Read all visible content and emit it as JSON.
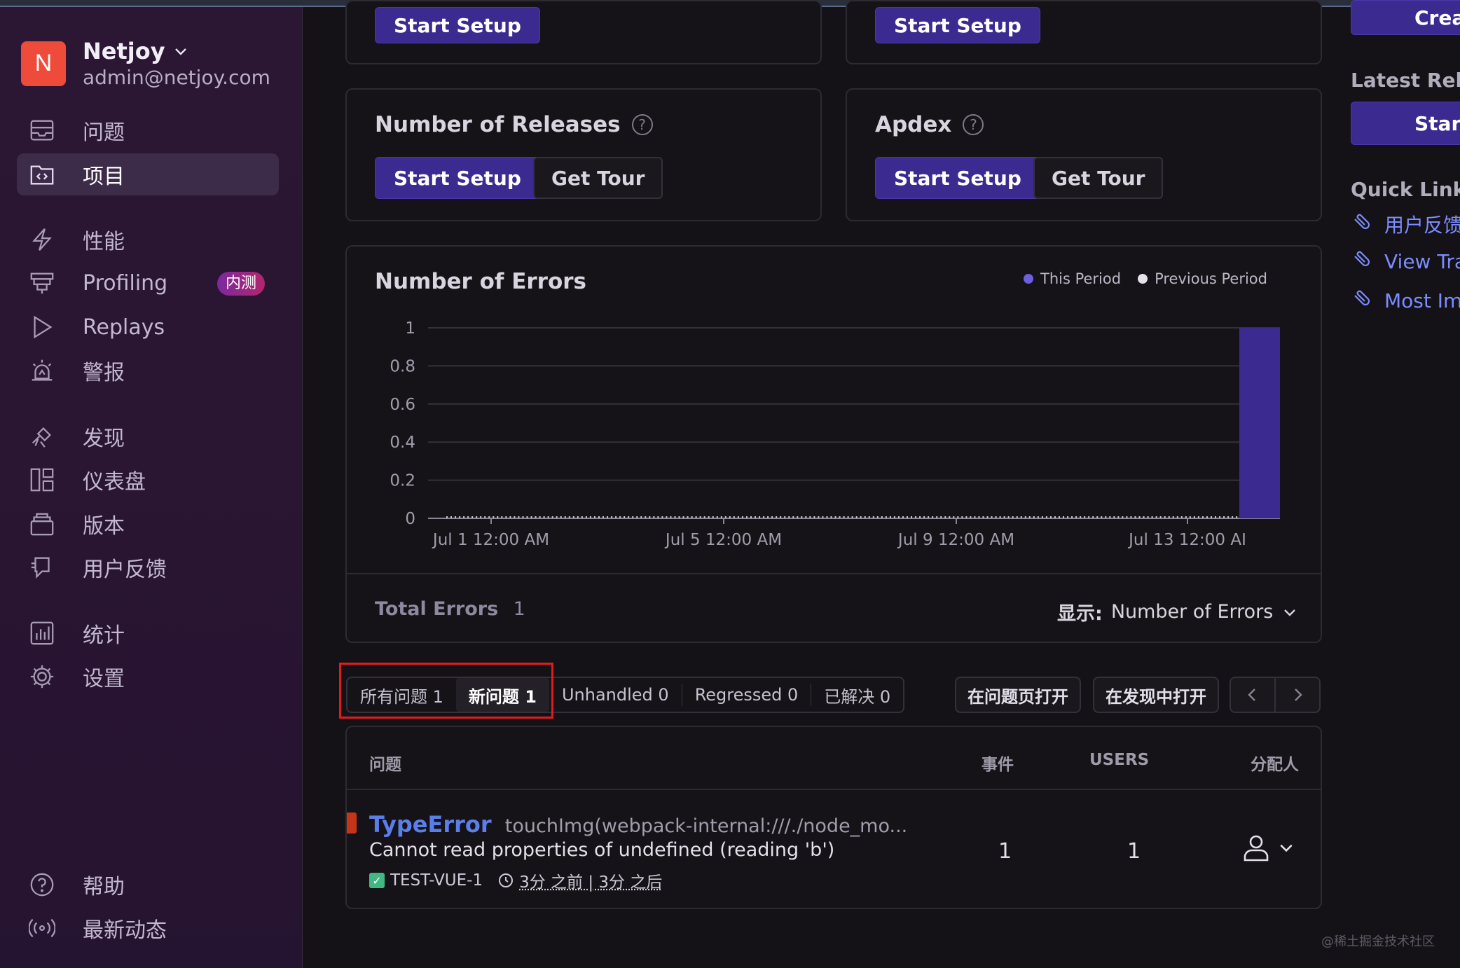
{
  "org": {
    "initial": "N",
    "name": "Netjoy",
    "email": "admin@netjoy.com"
  },
  "sidebar": {
    "items": [
      {
        "label": "问题",
        "icon": "issues-icon"
      },
      {
        "label": "项目",
        "icon": "projects-icon",
        "active": true
      },
      {
        "label": "性能",
        "icon": "performance-icon"
      },
      {
        "label": "Profiling",
        "icon": "profiling-icon",
        "badge": "内测"
      },
      {
        "label": "Replays",
        "icon": "replays-icon"
      },
      {
        "label": "警报",
        "icon": "alerts-icon"
      },
      {
        "label": "发现",
        "icon": "discover-icon"
      },
      {
        "label": "仪表盘",
        "icon": "dashboards-icon"
      },
      {
        "label": "版本",
        "icon": "releases-icon"
      },
      {
        "label": "用户反馈",
        "icon": "user-feedback-icon"
      },
      {
        "label": "统计",
        "icon": "stats-icon"
      },
      {
        "label": "设置",
        "icon": "settings-icon"
      }
    ],
    "bottom": [
      {
        "label": "帮助",
        "icon": "help-icon"
      },
      {
        "label": "最新动态",
        "icon": "broadcast-icon"
      }
    ]
  },
  "cards": {
    "top_left": {
      "start_setup": "Start Setup"
    },
    "top_right": {
      "start_setup": "Start Setup"
    },
    "releases": {
      "title": "Number of Releases",
      "start_setup": "Start Setup",
      "get_tour": "Get Tour"
    },
    "apdex": {
      "title": "Apdex",
      "start_setup": "Start Setup",
      "get_tour": "Get Tour"
    }
  },
  "errors_card": {
    "title": "Number of Errors",
    "total_label": "Total Errors",
    "total_value": "1",
    "display_label": "显示:",
    "display_value": "Number of Errors"
  },
  "colors": {
    "this_period": "#3b2b90",
    "previous_period": "#e6e2ea",
    "accent_link": "#7c8cff",
    "highlight": "#e21b1b"
  },
  "chart_data": {
    "type": "bar",
    "title": "Number of Errors",
    "legend": [
      "This Period",
      "Previous Period"
    ],
    "legend_position": "top-right",
    "x_tick_labels": [
      "Jul 1 12:00 AM",
      "Jul 5 12:00 AM",
      "Jul 9 12:00 AM",
      "Jul 13 12:00 AI"
    ],
    "y_tick_labels": [
      "1",
      "0.8",
      "0.6",
      "0.4",
      "0.2",
      "0"
    ],
    "ylim": [
      0,
      1
    ],
    "grid": true,
    "series": [
      {
        "name": "This Period",
        "values": [
          0,
          0,
          0,
          0,
          0,
          0,
          0,
          0,
          0,
          0,
          0,
          0,
          0,
          0,
          0,
          0,
          0,
          0,
          0,
          0,
          0,
          0,
          0,
          0,
          0,
          0,
          0,
          0,
          0,
          0,
          0,
          0,
          0,
          0,
          0,
          0,
          0,
          0,
          0,
          0,
          0,
          0,
          0,
          0,
          0,
          0,
          0,
          0,
          0,
          0,
          0,
          0,
          0,
          0,
          0,
          0,
          0,
          0,
          0,
          0,
          0,
          0,
          0,
          0,
          0,
          0,
          0,
          0,
          0,
          0,
          0,
          0,
          0,
          0,
          0,
          0,
          0,
          0,
          0,
          0,
          0,
          0,
          0,
          0,
          0,
          0,
          0,
          0,
          0,
          0,
          0,
          0,
          0,
          0,
          0,
          0,
          0,
          0,
          0,
          0,
          0,
          0,
          0,
          0,
          0,
          0,
          0,
          0,
          0,
          0,
          0,
          0,
          0,
          0,
          0,
          0,
          0,
          0,
          0,
          0,
          0,
          0,
          0,
          0,
          0,
          0,
          0,
          0,
          0,
          0,
          0,
          0,
          0,
          0,
          0,
          0,
          0,
          0,
          0,
          0,
          0,
          0,
          0,
          0,
          0,
          0,
          0,
          0,
          0,
          0,
          0,
          0,
          0,
          0,
          0,
          0,
          0,
          0,
          0,
          0,
          0,
          0,
          0,
          0,
          0,
          0,
          0,
          0,
          0,
          0,
          0,
          0,
          0,
          0,
          0,
          0,
          0,
          0,
          0,
          0,
          0,
          0,
          0,
          0,
          0,
          0,
          0,
          0,
          0,
          0,
          0,
          0,
          0,
          0,
          0,
          0,
          0,
          0,
          0,
          0,
          0,
          0,
          0,
          0,
          0,
          0,
          0,
          0,
          0,
          0,
          0,
          0,
          0,
          0,
          0,
          0,
          0,
          0,
          0,
          0,
          0,
          0,
          0,
          0,
          0,
          0,
          0,
          0,
          0,
          0,
          0,
          0,
          0,
          0,
          0,
          0,
          0,
          0,
          0,
          0,
          0,
          0,
          0,
          0,
          0,
          0,
          0,
          0,
          0,
          0,
          0,
          0,
          0,
          0,
          0,
          0,
          0,
          0,
          0,
          0,
          0,
          0,
          0,
          0,
          0,
          0,
          0,
          0,
          0,
          0,
          0,
          0,
          0,
          0,
          0,
          0,
          0,
          0,
          0,
          0,
          0,
          0,
          0,
          0,
          0,
          0,
          0,
          0,
          0,
          0,
          0,
          0,
          0,
          0,
          0,
          0,
          0,
          0,
          0,
          0,
          0,
          0,
          0,
          0,
          0,
          0,
          0,
          0,
          0,
          0,
          0,
          0,
          0,
          0,
          0,
          0,
          0,
          0,
          0,
          0,
          0,
          0,
          0,
          0,
          0,
          0,
          0,
          0,
          0,
          0,
          0,
          0,
          0,
          0,
          0,
          0,
          0,
          0,
          0,
          0,
          0,
          0,
          0,
          0,
          0,
          0,
          0,
          0,
          0,
          0,
          0,
          0,
          0,
          0,
          0,
          0,
          0,
          0,
          0,
          0,
          0,
          0,
          0,
          0,
          0,
          0,
          0,
          0,
          0,
          0,
          0,
          0,
          0,
          0,
          0,
          0,
          1
        ]
      }
    ]
  },
  "issue_tabs": [
    {
      "label": "所有问题 1"
    },
    {
      "label": "新问题 1",
      "active": true
    },
    {
      "label": "Unhandled 0"
    },
    {
      "label": "Regressed 0"
    },
    {
      "label": "已解决 0"
    }
  ],
  "issue_actions": {
    "open_in_issues": "在问题页打开",
    "open_in_discover": "在发现中打开"
  },
  "table": {
    "headers": {
      "issue": "问题",
      "events": "事件",
      "users": "USERS",
      "assignee": "分配人"
    },
    "rows": [
      {
        "type": "TypeError",
        "culprit": "touchImg(webpack-internal:///./node_mo...",
        "message": "Cannot read properties of undefined (reading 'b')",
        "project": "TEST-VUE-1",
        "time": "3分 之前 | 3分 之后",
        "events": "1",
        "users": "1"
      }
    ]
  },
  "right": {
    "create_btn": "Crea",
    "latest_releases": "Latest Relea",
    "start_btn": "Start",
    "quick_links": "Quick Links",
    "links": [
      "用户反馈",
      "View Tra",
      "Most Imp"
    ]
  },
  "watermark": "@稀土掘金技术社区"
}
